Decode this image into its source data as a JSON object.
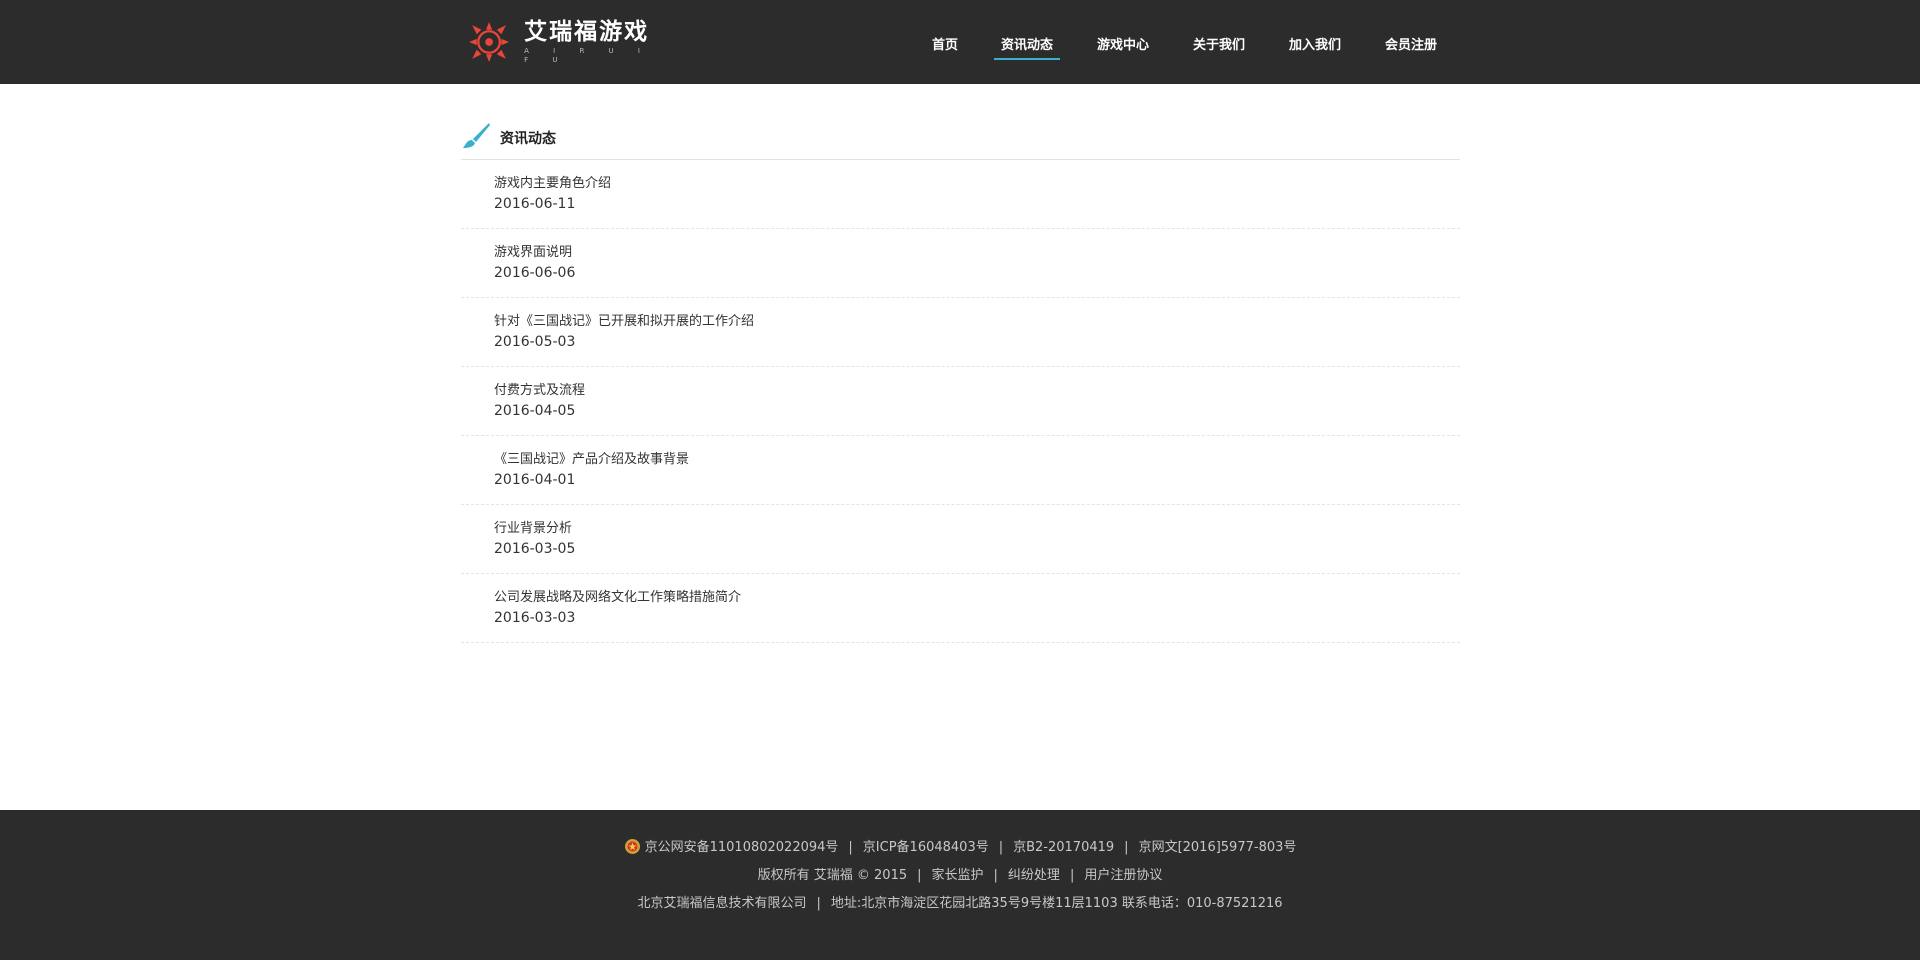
{
  "brand": {
    "name": "艾瑞福游戏",
    "sub": "A I R U I F U",
    "colors": {
      "logo_red": "#e8463a",
      "accent": "#3ab0cc",
      "header_bg": "#2c2c2c"
    }
  },
  "nav": {
    "items": [
      {
        "label": "首页"
      },
      {
        "label": "资讯动态",
        "active": true
      },
      {
        "label": "游戏中心"
      },
      {
        "label": "关于我们"
      },
      {
        "label": "加入我们"
      },
      {
        "label": "会员注册"
      }
    ]
  },
  "section": {
    "title": "资讯动态",
    "icon": "paintbrush-icon"
  },
  "news": [
    {
      "title": "游戏内主要角色介绍",
      "date": "2016-06-11"
    },
    {
      "title": "游戏界面说明",
      "date": "2016-06-06"
    },
    {
      "title": "针对《三国战记》已开展和拟开展的工作介绍",
      "date": "2016-05-03"
    },
    {
      "title": "付费方式及流程",
      "date": "2016-04-05"
    },
    {
      "title": "《三国战记》产品介绍及故事背景",
      "date": "2016-04-01"
    },
    {
      "title": "行业背景分析",
      "date": "2016-03-05"
    },
    {
      "title": "公司发展战略及网络文化工作策略措施简介",
      "date": "2016-03-03"
    }
  ],
  "footer": {
    "line1": {
      "police_icon": "police-badge-icon",
      "gongan": "京公网安备11010802022094号",
      "icp": "京ICP备16048403号",
      "b2": "京B2-20170419",
      "wangwen": "京网文[2016]5977-803号"
    },
    "line2": {
      "copyright": "版权所有 艾瑞福 © 2015",
      "parent_monitor": "家长监护",
      "dispute": "纠纷处理",
      "agreement": "用户注册协议"
    },
    "line3": {
      "company": "北京艾瑞福信息技术有限公司",
      "address": "地址:北京市海淀区花园北路35号9号楼11层1103 联系电话：010-87521216"
    }
  }
}
